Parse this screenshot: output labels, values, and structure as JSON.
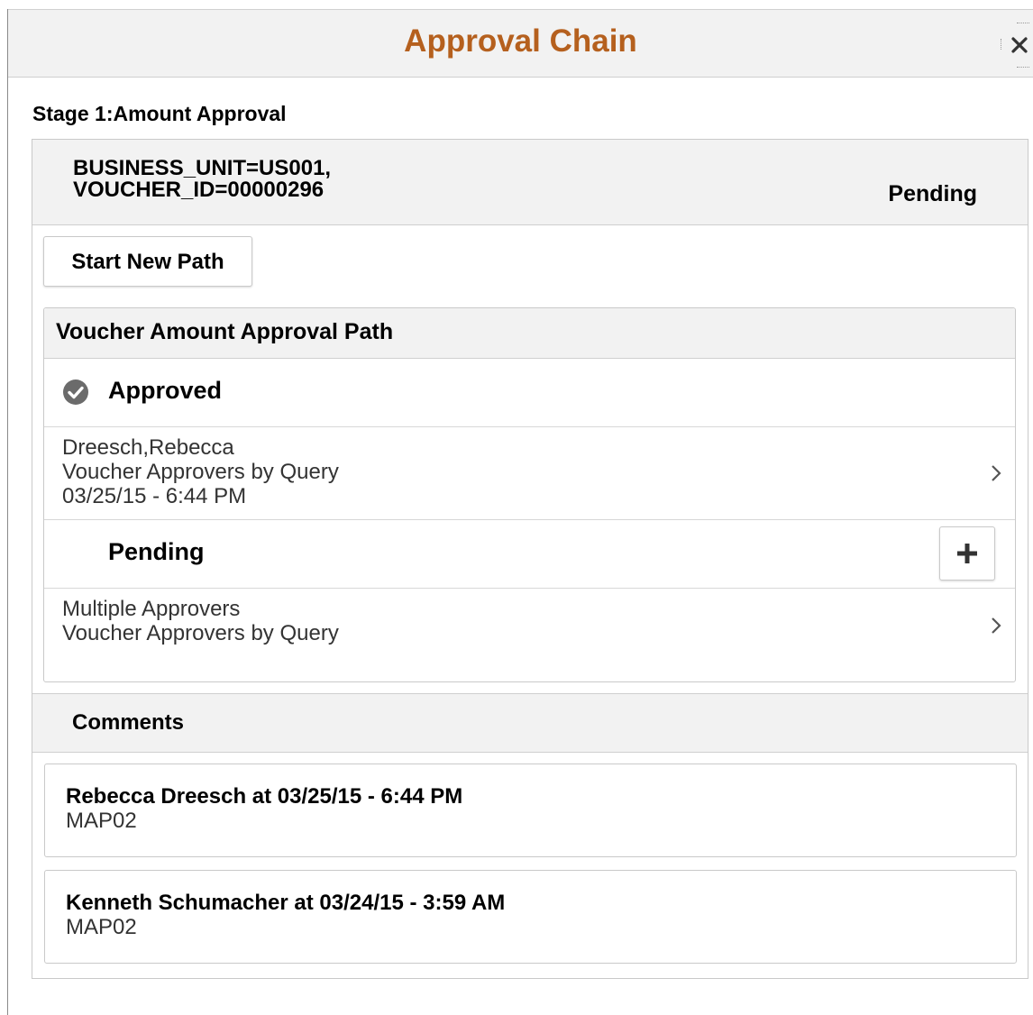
{
  "dialog": {
    "title": "Approval Chain",
    "close_label": "×"
  },
  "stage": {
    "label": "Stage 1:Amount Approval",
    "criteria_line1": "BUSINESS_UNIT=US001,",
    "criteria_line2": "VOUCHER_ID=00000296",
    "status": "Pending",
    "start_new_path_label": "Start New Path"
  },
  "path": {
    "title": "Voucher Amount Approval Path",
    "steps": [
      {
        "status": "Approved",
        "status_icon": "check-circle-icon",
        "approver": "Dreesch,Rebecca",
        "rule": "Voucher Approvers by Query",
        "datetime": "03/25/15 - 6:44 PM"
      },
      {
        "status": "Pending",
        "approver": "Multiple Approvers",
        "rule": "Voucher Approvers by Query"
      }
    ]
  },
  "comments": {
    "title": "Comments",
    "items": [
      {
        "author_line": "Rebecca Dreesch at 03/25/15 - 6:44 PM",
        "text": "MAP02"
      },
      {
        "author_line": "Kenneth Schumacher at 03/24/15 - 3:59 AM",
        "text": "MAP02"
      }
    ]
  },
  "colors": {
    "title": "#b5601e",
    "header_bg": "#f2f2f2",
    "border": "#c9c9c9"
  }
}
